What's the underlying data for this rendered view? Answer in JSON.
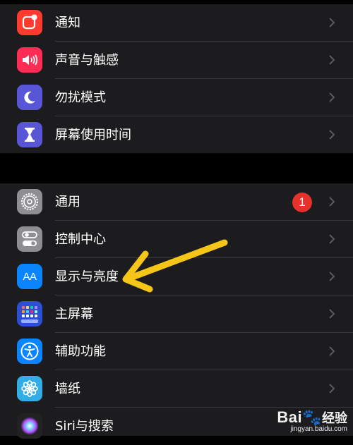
{
  "groups": [
    {
      "items": [
        {
          "label": "通知",
          "icon": "notifications-icon",
          "color": "#ff3b30"
        },
        {
          "label": "声音与触感",
          "icon": "speaker-icon",
          "color": "#ff2d55"
        },
        {
          "label": "勿扰模式",
          "icon": "moon-icon",
          "color": "#5856d6"
        },
        {
          "label": "屏幕使用时间",
          "icon": "hourglass-icon",
          "color": "#5856d6"
        }
      ]
    },
    {
      "items": [
        {
          "label": "通用",
          "icon": "gear-icon",
          "color": "#8e8e93",
          "badge": "1"
        },
        {
          "label": "控制中心",
          "icon": "toggles-icon",
          "color": "#8e8e93"
        },
        {
          "label": "显示与亮度",
          "icon": "display-aa-icon",
          "color": "#0a84ff",
          "icon_text": "AA"
        },
        {
          "label": "主屏幕",
          "icon": "home-grid-icon",
          "color": "#2c4fd6"
        },
        {
          "label": "辅助功能",
          "icon": "accessibility-icon",
          "color": "#0a84ff"
        },
        {
          "label": "墙纸",
          "icon": "flower-icon",
          "color": "#32ade6"
        },
        {
          "label": "Siri与搜索",
          "icon": "siri-icon",
          "color": "#222222"
        }
      ]
    }
  ],
  "annotation": {
    "arrow_color": "#f5c518",
    "target": "显示与亮度"
  },
  "watermark": {
    "brand_left": "Bai",
    "brand_right": "经验",
    "url": "jingyan.baidu.com"
  }
}
